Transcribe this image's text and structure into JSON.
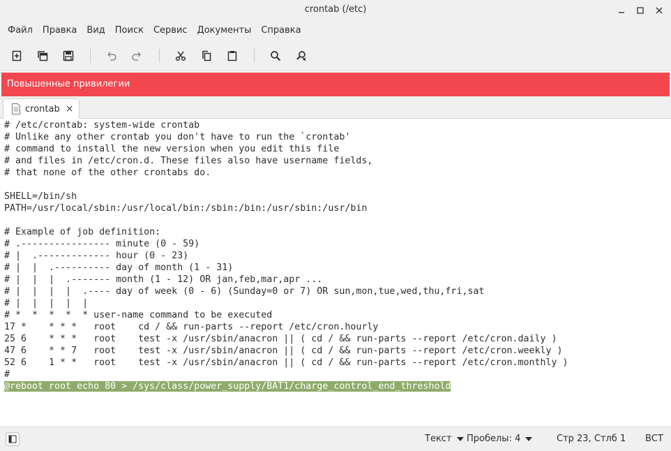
{
  "window": {
    "title": "crontab (/etc)"
  },
  "menu": [
    "Файл",
    "Правка",
    "Вид",
    "Поиск",
    "Сервис",
    "Документы",
    "Справка"
  ],
  "toolbar": {
    "icons": [
      "new-document-icon",
      "open-icon",
      "save-icon",
      "undo-icon",
      "redo-icon",
      "cut-icon",
      "copy-icon",
      "paste-icon",
      "search-icon",
      "search-replace-icon"
    ]
  },
  "banner": {
    "text": "Повышенные привилегии",
    "color": "#f2474f"
  },
  "tab": {
    "label": "crontab",
    "close": "×"
  },
  "editor": {
    "lines": [
      "# /etc/crontab: system-wide crontab",
      "# Unlike any other crontab you don't have to run the `crontab'",
      "# command to install the new version when you edit this file",
      "# and files in /etc/cron.d. These files also have username fields,",
      "# that none of the other crontabs do.",
      "",
      "SHELL=/bin/sh",
      "PATH=/usr/local/sbin:/usr/local/bin:/sbin:/bin:/usr/sbin:/usr/bin",
      "",
      "# Example of job definition:",
      "# .---------------- minute (0 - 59)",
      "# |  .------------- hour (0 - 23)",
      "# |  |  .---------- day of month (1 - 31)",
      "# |  |  |  .------- month (1 - 12) OR jan,feb,mar,apr ...",
      "# |  |  |  |  .---- day of week (0 - 6) (Sunday=0 or 7) OR sun,mon,tue,wed,thu,fri,sat",
      "# |  |  |  |  |",
      "# *  *  *  *  * user-name command to be executed",
      "17 *    * * *   root    cd / && run-parts --report /etc/cron.hourly",
      "25 6    * * *   root    test -x /usr/sbin/anacron || ( cd / && run-parts --report /etc/cron.daily )",
      "47 6    * * 7   root    test -x /usr/sbin/anacron || ( cd / && run-parts --report /etc/cron.weekly )",
      "52 6    1 * *   root    test -x /usr/sbin/anacron || ( cd / && run-parts --report /etc/cron.monthly )",
      "#",
      "@reboot root echo 80 > /sys/class/power_supply/BAT1/charge_control_end_threshold"
    ],
    "selected_line_index": 22,
    "selection_color": "#8fab6a"
  },
  "statusbar": {
    "syntax": "Текст",
    "indent": "Пробелы: 4",
    "position": "Стр 23, Стлб 1",
    "mode": "ВСТ"
  }
}
